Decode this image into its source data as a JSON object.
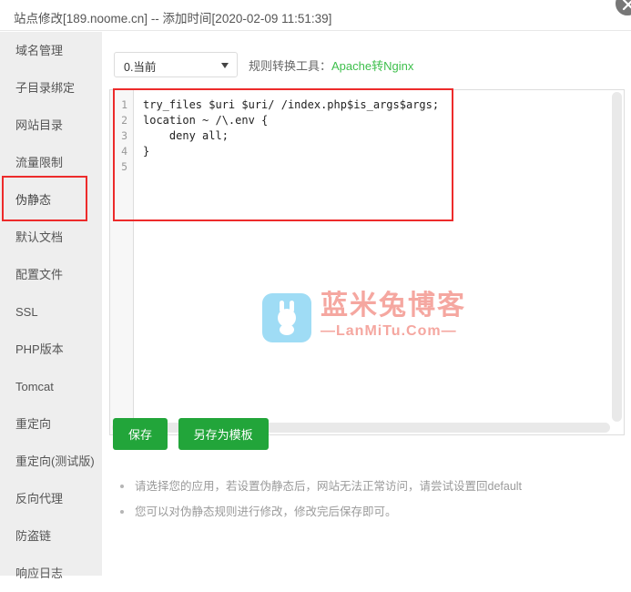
{
  "window": {
    "title": "站点修改[189.noome.cn] -- 添加时间[2020-02-09 11:51:39]",
    "close_icon": "close-icon"
  },
  "sidebar": {
    "items": [
      {
        "label": "域名管理",
        "active": false
      },
      {
        "label": "子目录绑定",
        "active": false
      },
      {
        "label": "网站目录",
        "active": false
      },
      {
        "label": "流量限制",
        "active": false
      },
      {
        "label": "伪静态",
        "active": true
      },
      {
        "label": "默认文档",
        "active": false
      },
      {
        "label": "配置文件",
        "active": false
      },
      {
        "label": "SSL",
        "active": false
      },
      {
        "label": "PHP版本",
        "active": false
      },
      {
        "label": "Tomcat",
        "active": false
      },
      {
        "label": "重定向",
        "active": false
      },
      {
        "label": "重定向(测试版)",
        "active": false
      },
      {
        "label": "反向代理",
        "active": false
      },
      {
        "label": "防盗链",
        "active": false
      },
      {
        "label": "响应日志",
        "active": false
      }
    ]
  },
  "toolbar": {
    "select_value": "0.当前",
    "select_options": [
      "0.当前"
    ],
    "caret_icon": "chevron-down-icon",
    "tool_label": "规则转换工具：",
    "tool_link": "Apache转Nginx"
  },
  "editor": {
    "line_numbers": [
      "1",
      "2",
      "3",
      "4",
      "5"
    ],
    "lines": [
      "try_files $uri $uri/ /index.php$is_args$args;",
      "location ~ /\\.env {",
      "    deny all;",
      "}",
      ""
    ]
  },
  "watermark": {
    "icon_name": "rabbit-logo-icon",
    "cn_text": "蓝米兔博客",
    "en_text": "—LanMiTu.Com—",
    "icon_color": "#9fdcf5",
    "text_color": "#f5a7a0"
  },
  "actions": {
    "save_label": "保存",
    "save_as_template_label": "另存为模板",
    "button_color": "#22a53a"
  },
  "tips": [
    "请选择您的应用，若设置伪静态后，网站无法正常访问，请尝试设置回default",
    "您可以对伪静态规则进行修改，修改完后保存即可。"
  ],
  "annotations": {
    "highlight_color": "#ed2b2b"
  }
}
